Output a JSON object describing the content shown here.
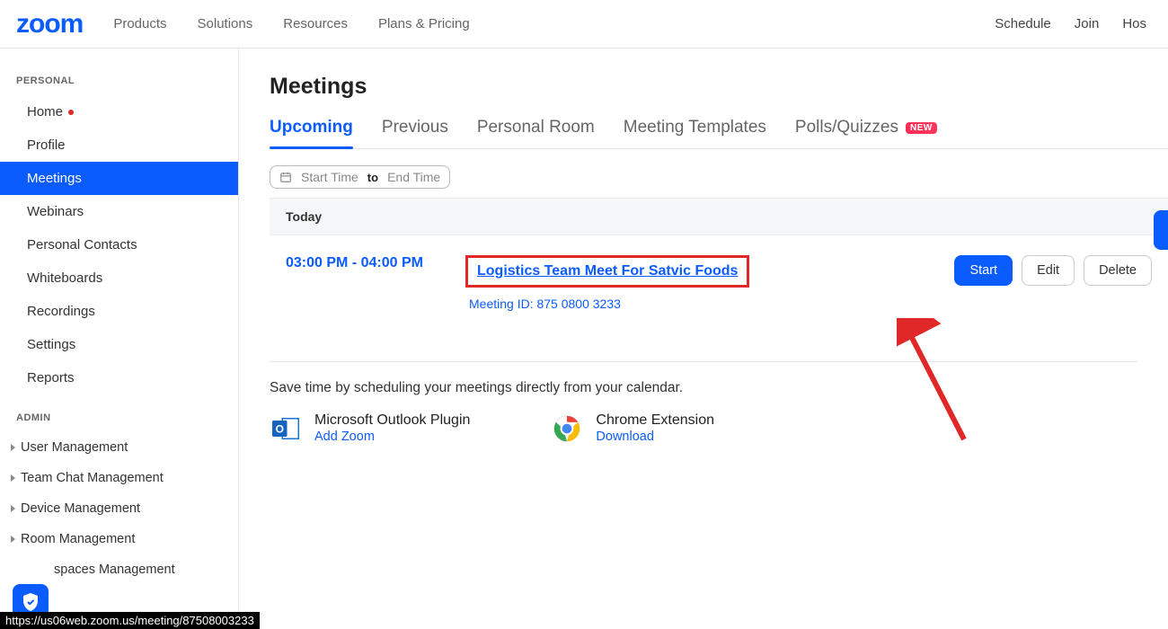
{
  "topnav": {
    "logo": "zoom",
    "left": [
      "Products",
      "Solutions",
      "Resources",
      "Plans & Pricing"
    ],
    "right": [
      "Schedule",
      "Join",
      "Hos"
    ]
  },
  "sidebar": {
    "personal_heading": "PERSONAL",
    "personal": [
      {
        "label": "Home",
        "dot": true
      },
      {
        "label": "Profile"
      },
      {
        "label": "Meetings",
        "active": true
      },
      {
        "label": "Webinars"
      },
      {
        "label": "Personal Contacts"
      },
      {
        "label": "Whiteboards"
      },
      {
        "label": "Recordings"
      },
      {
        "label": "Settings"
      },
      {
        "label": "Reports"
      }
    ],
    "admin_heading": "ADMIN",
    "admin": [
      {
        "label": "User Management"
      },
      {
        "label": "Team Chat Management"
      },
      {
        "label": "Device Management"
      },
      {
        "label": "Room Management"
      },
      {
        "label": "spaces Management"
      }
    ]
  },
  "main": {
    "title": "Meetings",
    "tabs": [
      {
        "label": "Upcoming",
        "active": true
      },
      {
        "label": "Previous"
      },
      {
        "label": "Personal Room"
      },
      {
        "label": "Meeting Templates"
      },
      {
        "label": "Polls/Quizzes",
        "badge": "NEW"
      }
    ],
    "filter": {
      "start_ph": "Start Time",
      "to": "to",
      "end_ph": "End Time"
    },
    "today_label": "Today",
    "meeting": {
      "time": "03:00 PM - 04:00 PM",
      "title": "Logistics Team Meet For Satvic Foods",
      "meeting_id_label": "Meeting ID: 875 0800 3233",
      "actions": {
        "start": "Start",
        "edit": "Edit",
        "delete": "Delete"
      }
    },
    "calendar_tip": "Save time by scheduling your meetings directly from your calendar.",
    "plugins": {
      "outlook": {
        "title": "Microsoft Outlook Plugin",
        "link": "Add Zoom"
      },
      "chrome": {
        "title": "Chrome Extension",
        "link": "Download"
      }
    }
  },
  "status_bar": "https://us06web.zoom.us/meeting/87508003233"
}
